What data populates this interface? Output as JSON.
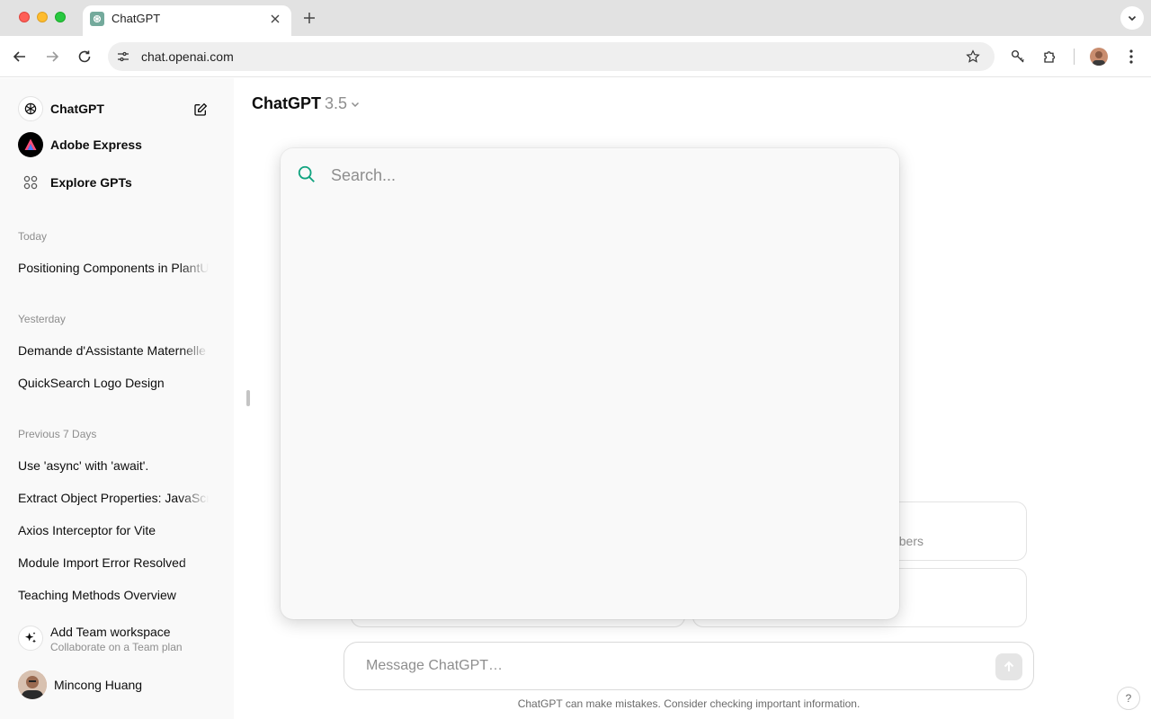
{
  "browser": {
    "tab_title": "ChatGPT",
    "url": "chat.openai.com"
  },
  "sidebar": {
    "top": [
      {
        "label": "ChatGPT",
        "icon": "openai-logo-icon"
      },
      {
        "label": "Adobe Express",
        "icon": "adobe-express-icon"
      },
      {
        "label": "Explore GPTs",
        "icon": "grid-icon"
      }
    ],
    "sections": [
      {
        "title": "Today",
        "items": [
          "Positioning Components in PlantUML"
        ]
      },
      {
        "title": "Yesterday",
        "items": [
          "Demande d'Assistante Maternelle",
          "QuickSearch Logo Design"
        ]
      },
      {
        "title": "Previous 7 Days",
        "items": [
          "Use 'async' with 'await'.",
          "Extract Object Properties: JavaScript",
          "Axios Interceptor for Vite",
          "Module Import Error Resolved",
          "Teaching Methods Overview"
        ]
      }
    ],
    "team": {
      "title": "Add Team workspace",
      "subtitle": "Collaborate on a Team plan"
    },
    "user": {
      "name": "Mincong Huang"
    }
  },
  "main": {
    "model_name": "ChatGPT",
    "model_version": "3.5",
    "suggestion_partial": "bers",
    "composer_placeholder": "Message ChatGPT…",
    "disclaimer": "ChatGPT can make mistakes. Consider checking important information.",
    "help": "?"
  },
  "search": {
    "placeholder": "Search..."
  },
  "colors": {
    "accent": "#10a37f",
    "sidebar_bg": "#f9f9f9",
    "tabbar_bg": "#e2e2e2"
  }
}
